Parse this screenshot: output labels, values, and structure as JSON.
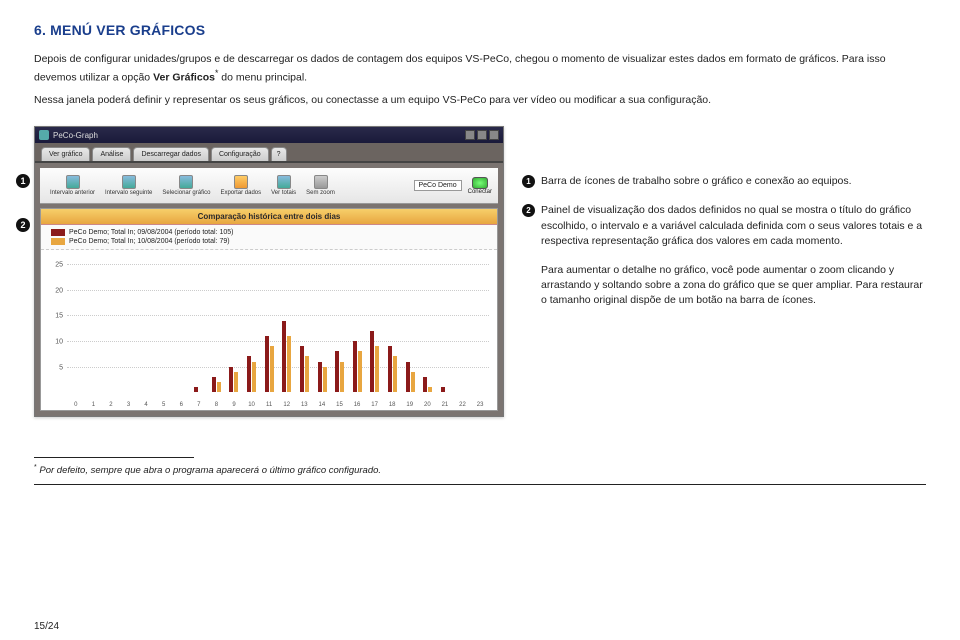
{
  "heading": "6. MENÚ VER GRÁFICOS",
  "para1_a": "Depois de configurar unidades/grupos e de descarregar os dados de contagem dos equipos VS-PeCo, chegou o momento de visualizar estes dados em formato de gráficos. Para isso devemos utilizar a opção ",
  "para1_bold": "Ver Gráficos",
  "para1_b": " do menu principal.",
  "para1_sup": "*",
  "para2": "Nessa janela poderá definir y representar os seus gráficos, ou conectasse a um equipo VS-PeCo para ver vídeo ou modificar a sua configuração.",
  "app": {
    "title": "PeCo-Graph",
    "tabs": [
      "Ver gráfico",
      "Análise",
      "Descarregar dados",
      "Configuração",
      "?"
    ],
    "toolbar": {
      "prev": "Intervalo anterior",
      "next": "Intervalo seguinte",
      "select": "Selecionar gráfico",
      "export": "Exportar dados",
      "totals": "Ver totais",
      "nozoom": "Sem zoom",
      "device": "PeCo Demo",
      "connect": "Conectar"
    }
  },
  "chart_data": {
    "type": "bar",
    "title": "Comparação histórica entre dois dias",
    "legend": [
      "PeCo Demo; Total In; 09/08/2004 (período total: 105)",
      "PeCo Demo; Total In; 10/08/2004 (período total: 79)"
    ],
    "ylabel": "",
    "yticks": [
      5,
      10,
      15,
      20,
      25
    ],
    "ylim": [
      0,
      27
    ],
    "categories": [
      "0",
      "1",
      "2",
      "3",
      "4",
      "5",
      "6",
      "7",
      "8",
      "9",
      "10",
      "11",
      "12",
      "13",
      "14",
      "15",
      "16",
      "17",
      "18",
      "19",
      "20",
      "21",
      "22",
      "23"
    ],
    "series": [
      {
        "name": "09/08/2004",
        "values": [
          0,
          0,
          0,
          0,
          0,
          0,
          0,
          1,
          3,
          5,
          7,
          11,
          14,
          9,
          6,
          8,
          10,
          12,
          9,
          6,
          3,
          1,
          0,
          0
        ]
      },
      {
        "name": "10/08/2004",
        "values": [
          0,
          0,
          0,
          0,
          0,
          0,
          0,
          0,
          2,
          4,
          6,
          9,
          11,
          7,
          5,
          6,
          8,
          9,
          7,
          4,
          1,
          0,
          0,
          0
        ]
      }
    ]
  },
  "markers": {
    "m1": "1",
    "m2": "2"
  },
  "desc": {
    "d1": "Barra de ícones de trabalho sobre o gráfico e conexão ao equipos.",
    "d2": "Painel de visualização dos dados definidos no qual se mostra o título do gráfico escolhido, o intervalo e a variável calculada definida com o seus valores totais e a respectiva representação gráfica dos valores em cada momento.",
    "d3": "Para aumentar o detalhe no gráfico, você pode aumentar o zoom clicando y arrastando y soltando sobre a zona do gráfico que se quer ampliar. Para restaurar o tamanho original dispõe de um botão na barra de ícones."
  },
  "footnote": "Por defeito, sempre que abra o programa aparecerá o último gráfico configurado.",
  "footnote_ast": "*",
  "pagenum": "15/24"
}
